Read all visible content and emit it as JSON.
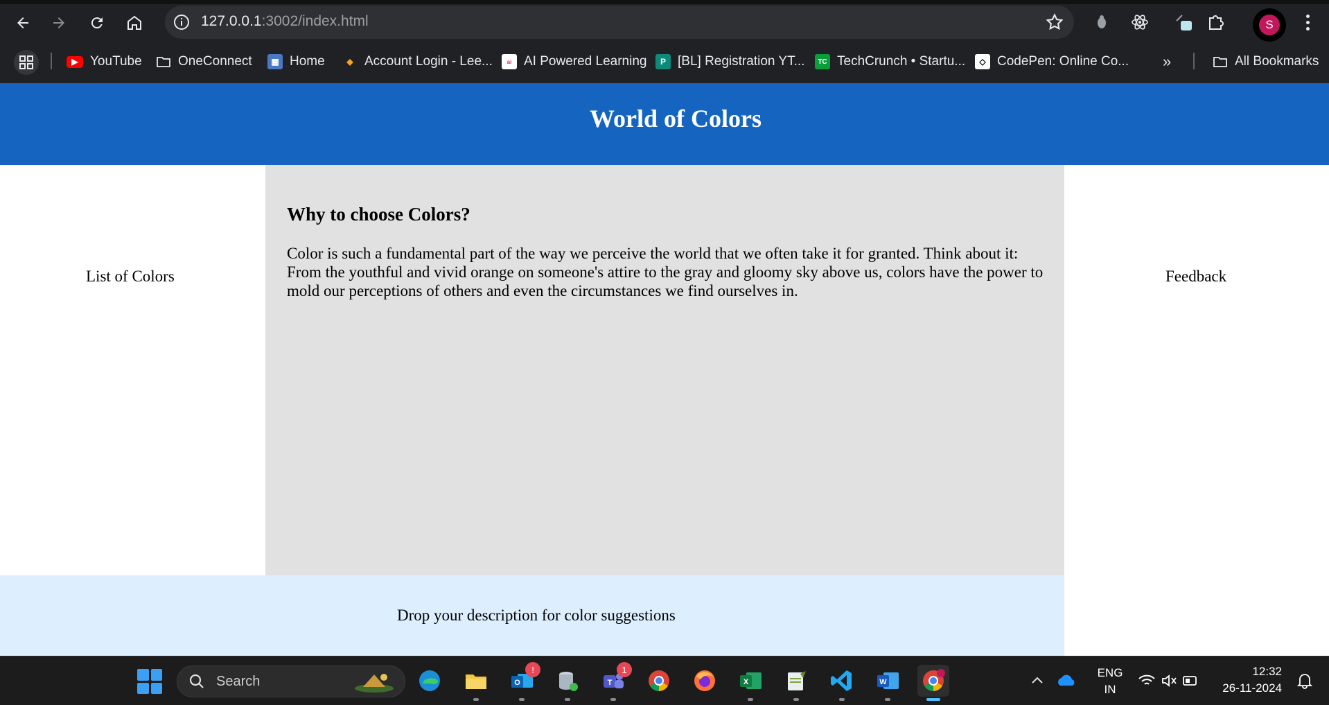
{
  "browser": {
    "url_host": "127.0.0.1",
    "url_path": ":3002/index.html",
    "bookmarks": [
      {
        "label": "YouTube",
        "icon": "youtube-icon"
      },
      {
        "label": "OneConnect",
        "icon": "folder-icon"
      },
      {
        "label": "Home",
        "icon": "home-favicon"
      },
      {
        "label": "Account Login - Lee...",
        "icon": "account-favicon"
      },
      {
        "label": "AI Powered Learning",
        "icon": "learning-favicon"
      },
      {
        "label": "[BL] Registration YT...",
        "icon": "p-favicon"
      },
      {
        "label": "TechCrunch • Startu...",
        "icon": "techcrunch-favicon"
      },
      {
        "label": "CodePen: Online Co...",
        "icon": "codepen-favicon"
      }
    ],
    "all_bookmarks": "All Bookmarks",
    "profile_initial": "S",
    "accent_profile": "#c2185b"
  },
  "page": {
    "title": "World of Colors",
    "left_nav": "List of Colors",
    "right_nav": "Feedback",
    "main_heading": "Why to choose Colors?",
    "main_paragraph": "Color is such a fundamental part of the way we perceive the world that we often take it for granted. Think about it: From the youthful and vivid orange on someone's attire to the gray and gloomy sky above us, colors have the power to mold our perceptions of others and even the circumstances we find ourselves in.",
    "footer_text": "Drop your description for color suggestions",
    "colors": {
      "header": "#1565c0",
      "main": "#e1e1e1",
      "footer": "#ddeeff"
    }
  },
  "taskbar": {
    "search_placeholder": "Search",
    "apps": [
      {
        "name": "edge-icon"
      },
      {
        "name": "file-explorer-icon"
      },
      {
        "name": "outlook-icon",
        "badge": "!"
      },
      {
        "name": "database-icon"
      },
      {
        "name": "teams-icon",
        "badge": "1"
      },
      {
        "name": "chrome-icon"
      },
      {
        "name": "firefox-icon"
      },
      {
        "name": "excel-icon"
      },
      {
        "name": "notepad-icon"
      },
      {
        "name": "vscode-icon"
      },
      {
        "name": "word-icon"
      },
      {
        "name": "chrome-profile-icon"
      }
    ],
    "language_line1": "ENG",
    "language_line2": "IN",
    "time": "12:32",
    "date": "26-11-2024"
  }
}
